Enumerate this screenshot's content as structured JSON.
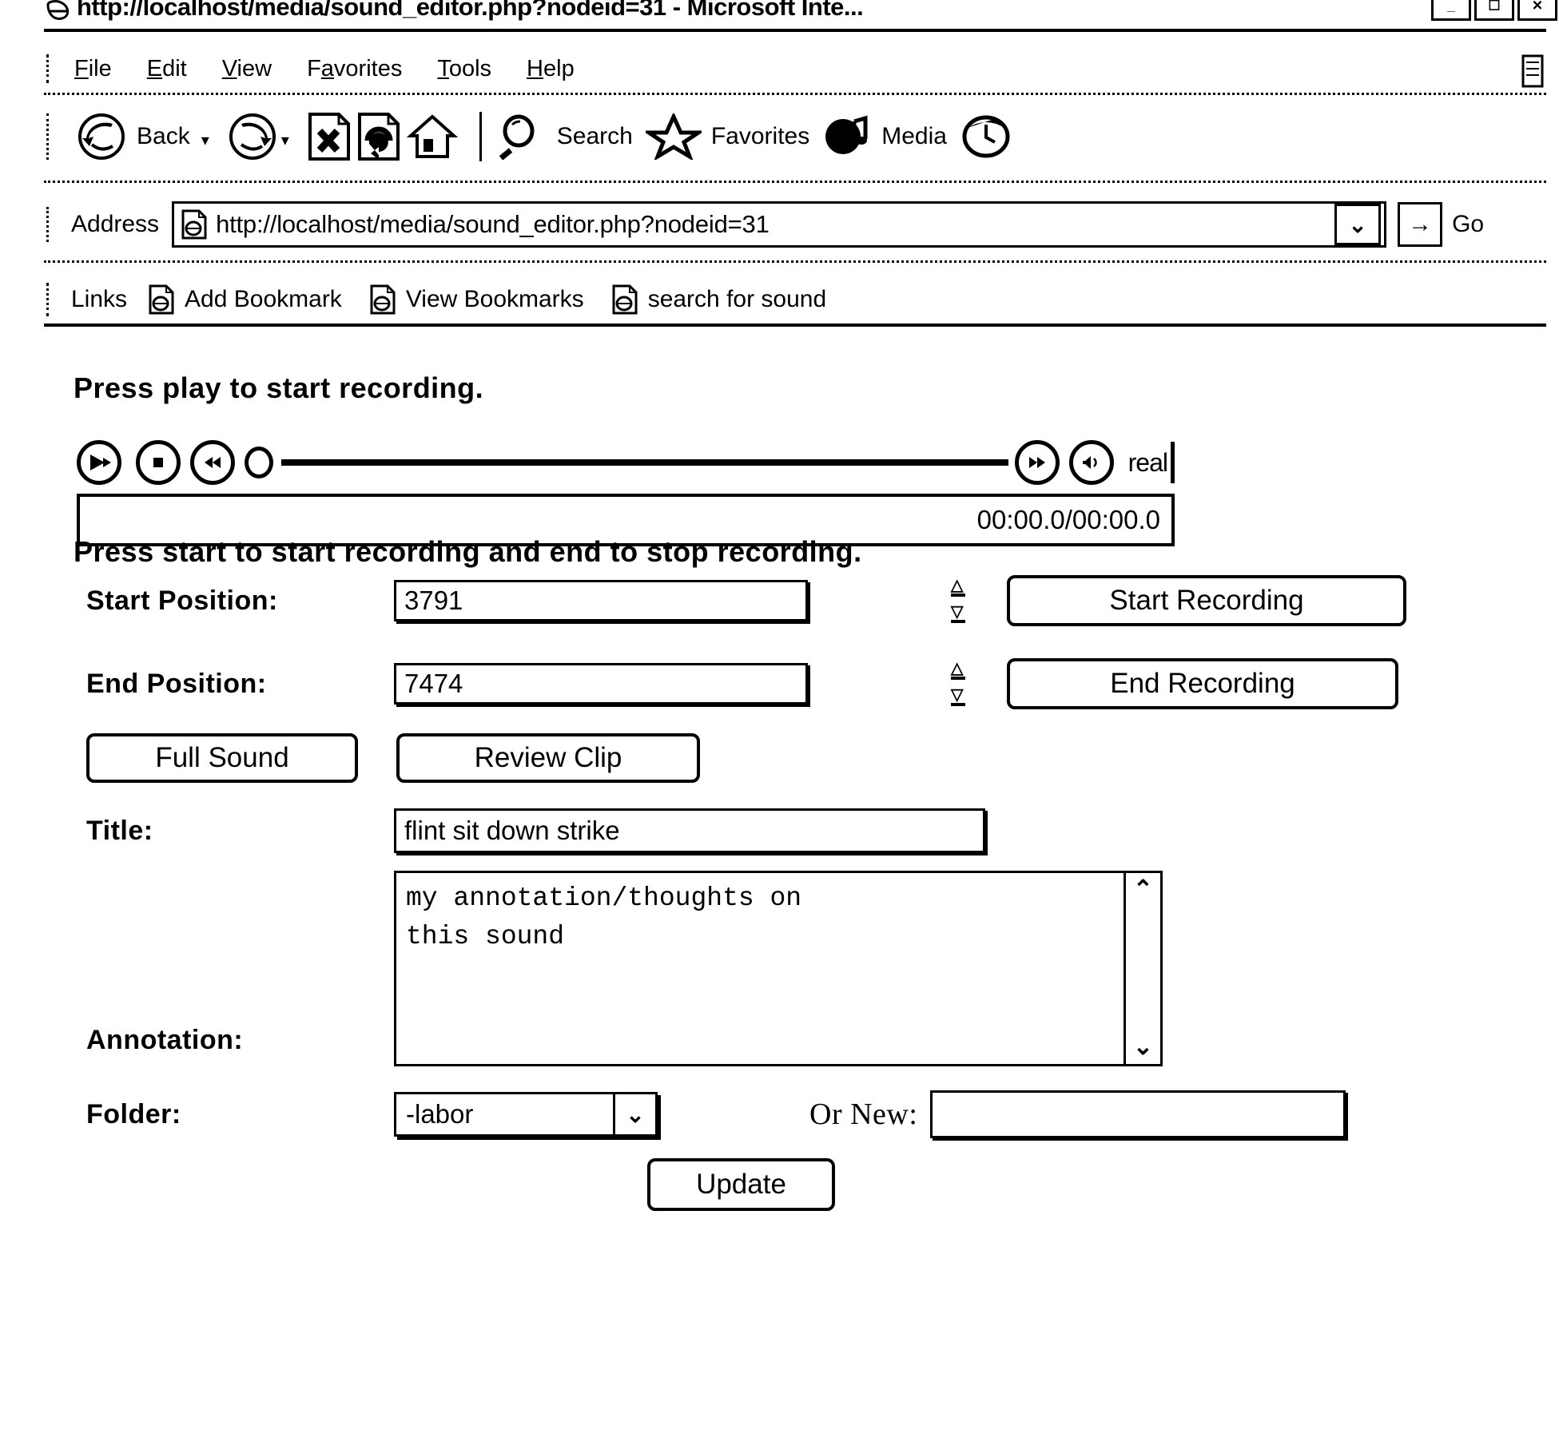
{
  "window": {
    "title": "http://localhost/media/sound_editor.php?nodeid=31 - Microsoft Inte...",
    "minimize_glyph": "_",
    "maximize_glyph": "☐",
    "close_glyph": "✕"
  },
  "menu": {
    "items": [
      {
        "label": "File",
        "accel": "F"
      },
      {
        "label": "Edit",
        "accel": "E"
      },
      {
        "label": "View",
        "accel": "V"
      },
      {
        "label": "Favorites",
        "accel": "a"
      },
      {
        "label": "Tools",
        "accel": "T"
      },
      {
        "label": "Help",
        "accel": "H"
      }
    ]
  },
  "toolbar": {
    "back_label": "Back",
    "back_icon": "back-arrow-icon",
    "forward_icon": "forward-arrow-icon",
    "stop_icon": "stop-page-icon",
    "refresh_icon": "refresh-page-icon",
    "home_icon": "home-icon",
    "search_label": "Search",
    "search_icon": "magnifier-icon",
    "favorites_label": "Favorites",
    "favorites_icon": "star-icon",
    "media_label": "Media",
    "media_icon": "media-note-icon",
    "history_icon": "history-clock-icon",
    "dropdown_glyph": "▾"
  },
  "address": {
    "label": "Address",
    "page_icon": "page-icon",
    "url": "http://localhost/media/sound_editor.php?nodeid=31",
    "dropdown_glyph": "⌄",
    "go_glyph": "→",
    "go_label": "Go"
  },
  "links": {
    "caption": "Links",
    "items": [
      {
        "label": "Add Bookmark",
        "icon": "bookmark-page-icon"
      },
      {
        "label": "View Bookmarks",
        "icon": "bookmark-page-icon"
      },
      {
        "label": "search for sound",
        "icon": "bookmark-page-icon"
      }
    ]
  },
  "content": {
    "heading_play": "Press play to start recording.",
    "heading_record": "Press start to start recording and end to stop recording."
  },
  "player": {
    "play_icon": "play-icon",
    "stop_icon": "stop-icon",
    "rewind_icon": "rewind-icon",
    "forward_icon": "fast-forward-icon",
    "volume_icon": "volume-icon",
    "brand": "real",
    "time": "00:00.0/00:00.0",
    "position_percent": 0
  },
  "form": {
    "start_position": {
      "label": "Start Position:",
      "value": "3791",
      "placeholder": ""
    },
    "end_position": {
      "label": "End Position:",
      "value": "7474",
      "placeholder": ""
    },
    "spinner_up_glyph": "△",
    "spinner_down_glyph": "▽",
    "start_recording_label": "Start Recording",
    "end_recording_label": "End Recording",
    "full_sound_label": "Full Sound",
    "review_clip_label": "Review Clip",
    "title": {
      "label": "Title:",
      "value": "flint sit down strike",
      "placeholder": ""
    },
    "annotation": {
      "label": "Annotation:",
      "value": "my annotation/thoughts on\nthis sound",
      "placeholder": "",
      "scroll_up_glyph": "⌃",
      "scroll_down_glyph": "⌄"
    },
    "folder": {
      "label": "Folder:",
      "selected": "-labor",
      "options": [
        "-labor"
      ],
      "arrow_glyph": "⌄"
    },
    "or_new": {
      "label": "Or New:",
      "value": "",
      "placeholder": ""
    },
    "update_label": "Update"
  }
}
